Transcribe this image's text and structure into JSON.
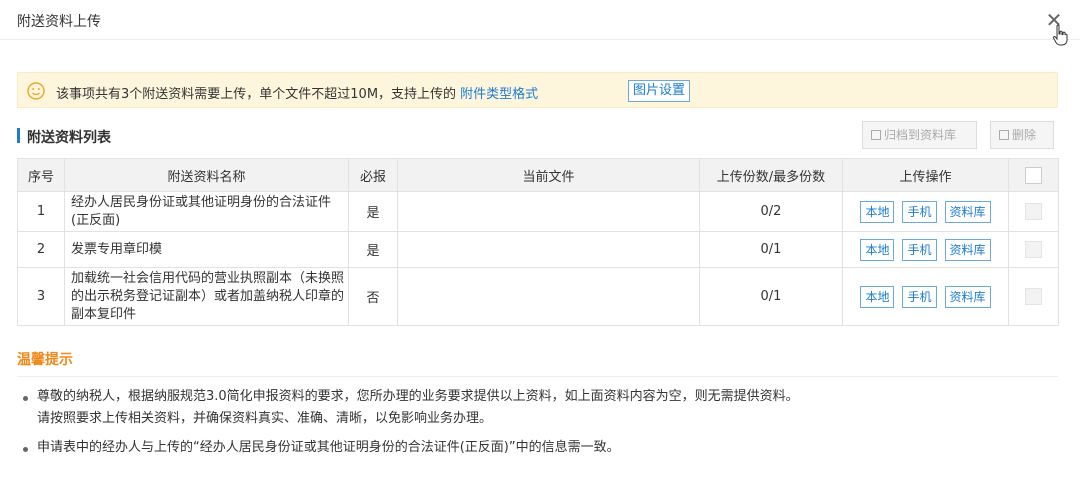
{
  "dialog": {
    "title": "附送资料上传",
    "close_icon": "close-icon"
  },
  "notice": {
    "text_prefix": "该事项共有3个附送资料需要上传，单个文件不超过10M，支持上传的",
    "link": "附件类型格式",
    "image_settings": "图片设置",
    "icon": "smile-icon",
    "background": "#fdf6dd"
  },
  "section": {
    "title": "附送资料列表",
    "archive_button": "归档到资料库",
    "delete_button": "删除"
  },
  "table": {
    "headers": [
      "序号",
      "附送资料名称",
      "必报",
      "当前文件",
      "上传份数/最多份数",
      "上传操作"
    ],
    "rows": [
      {
        "index": "1",
        "name": "经办人居民身份证或其他证明身份的合法证件(正反面)",
        "required": "是",
        "current_file": "",
        "count": "0/2"
      },
      {
        "index": "2",
        "name": "发票专用章印模",
        "required": "是",
        "current_file": "",
        "count": "0/1"
      },
      {
        "index": "3",
        "name": "加载统一社会信用代码的营业执照副本（未换照的出示税务登记证副本）或者加盖纳税人印章的副本复印件",
        "required": "否",
        "current_file": "",
        "count": "0/1"
      }
    ],
    "ops": {
      "local": "本地",
      "phone": "手机",
      "library": "资料库"
    }
  },
  "tips": {
    "title": "温馨提示",
    "items": [
      "尊敬的纳税人，根据纳服规范3.0简化申报资料的要求，您所办理的业务要求提供以上资料，如上面资料内容为空，则无需提供资料。",
      "请按照要求上传相关资料，并确保资料真实、准确、清晰，以免影响业务办理。",
      "申请表中的经办人与上传的“经办人居民身份证或其他证明身份的合法证件(正反面)”中的信息需一致。"
    ]
  },
  "colors": {
    "accent": "#1d7ccf",
    "tips_title": "#f0881a"
  }
}
